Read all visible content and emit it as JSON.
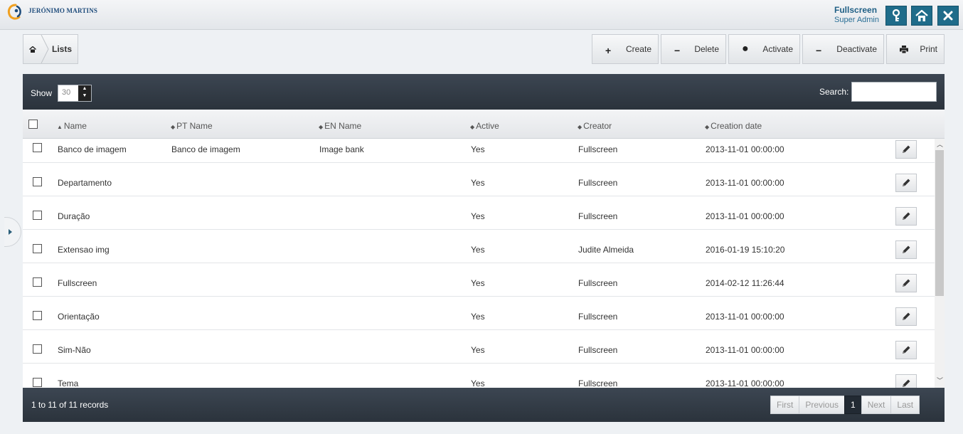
{
  "header": {
    "brand": "JERÓNIMO MARTINS",
    "user_name": "Fullscreen",
    "user_role": "Super Admin",
    "colors": {
      "accent": "#1f6c8a",
      "panel": "#323a44"
    }
  },
  "breadcrumb": {
    "label": "Lists"
  },
  "toolbar": {
    "create": "Create",
    "delete": "Delete",
    "activate": "Activate",
    "deactivate": "Deactivate",
    "print": "Print"
  },
  "table_controls": {
    "show_label": "Show",
    "show_value": "30",
    "search_label": "Search:",
    "search_value": ""
  },
  "columns": [
    "Name",
    "PT Name",
    "EN Name",
    "Active",
    "Creator",
    "Creation date"
  ],
  "rows": [
    {
      "name": "Banco de imagem",
      "pt_name": "Banco de imagem",
      "en_name": "Image bank",
      "active": "Yes",
      "creator": "Fullscreen",
      "date": "2013-11-01 00:00:00"
    },
    {
      "name": "Departamento",
      "pt_name": "",
      "en_name": "",
      "active": "Yes",
      "creator": "Fullscreen",
      "date": "2013-11-01 00:00:00"
    },
    {
      "name": "Duração",
      "pt_name": "",
      "en_name": "",
      "active": "Yes",
      "creator": "Fullscreen",
      "date": "2013-11-01 00:00:00"
    },
    {
      "name": "Extensao img",
      "pt_name": "",
      "en_name": "",
      "active": "Yes",
      "creator": "Judite Almeida",
      "date": "2016-01-19 15:10:20"
    },
    {
      "name": "Fullscreen",
      "pt_name": "",
      "en_name": "",
      "active": "Yes",
      "creator": "Fullscreen",
      "date": "2014-02-12 11:26:44"
    },
    {
      "name": "Orientação",
      "pt_name": "",
      "en_name": "",
      "active": "Yes",
      "creator": "Fullscreen",
      "date": "2013-11-01 00:00:00"
    },
    {
      "name": "Sim-Não",
      "pt_name": "",
      "en_name": "",
      "active": "Yes",
      "creator": "Fullscreen",
      "date": "2013-11-01 00:00:00"
    },
    {
      "name": "Tema",
      "pt_name": "",
      "en_name": "",
      "active": "Yes",
      "creator": "Fullscreen",
      "date": "2013-11-01 00:00:00"
    }
  ],
  "footer": {
    "records": "1 to 11 of 11 records",
    "pager": {
      "first": "First",
      "previous": "Previous",
      "current": "1",
      "next": "Next",
      "last": "Last"
    }
  }
}
